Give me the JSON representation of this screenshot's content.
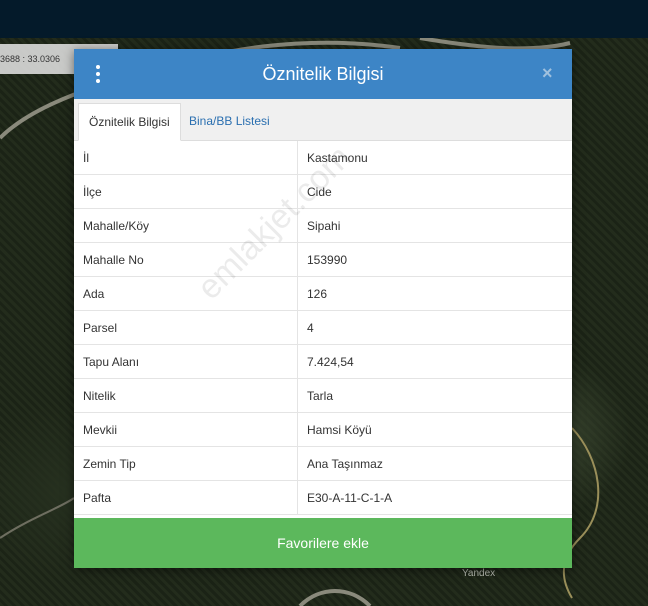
{
  "map": {
    "coordinate_readout": "3688 : 33.0306",
    "attribution": "Yandex"
  },
  "modal": {
    "title": "Öznitelik Bilgisi",
    "menu_icon": "vertical-dots-icon",
    "close_icon": "close-icon",
    "close_symbol": "×",
    "tabs": [
      {
        "label": "Öznitelik Bilgisi",
        "active": true
      },
      {
        "label": "Bina/BB Listesi",
        "active": false
      }
    ],
    "rows": [
      {
        "label": "İl",
        "value": "Kastamonu"
      },
      {
        "label": "İlçe",
        "value": "Cide"
      },
      {
        "label": "Mahalle/Köy",
        "value": "Sipahi"
      },
      {
        "label": "Mahalle No",
        "value": "153990"
      },
      {
        "label": "Ada",
        "value": "126"
      },
      {
        "label": "Parsel",
        "value": "4"
      },
      {
        "label": "Tapu Alanı",
        "value": "7.424,54"
      },
      {
        "label": "Nitelik",
        "value": "Tarla"
      },
      {
        "label": "Mevkii",
        "value": "Hamsi Köyü"
      },
      {
        "label": "Zemin Tip",
        "value": "Ana Taşınmaz"
      },
      {
        "label": "Pafta",
        "value": "E30-A-11-C-1-A"
      }
    ],
    "favorite_button": "Favorilere ekle"
  },
  "watermark": "emlakjet.com",
  "colors": {
    "header": "#3d85c6",
    "button": "#5cb85c",
    "topbar": "#041a2a"
  }
}
